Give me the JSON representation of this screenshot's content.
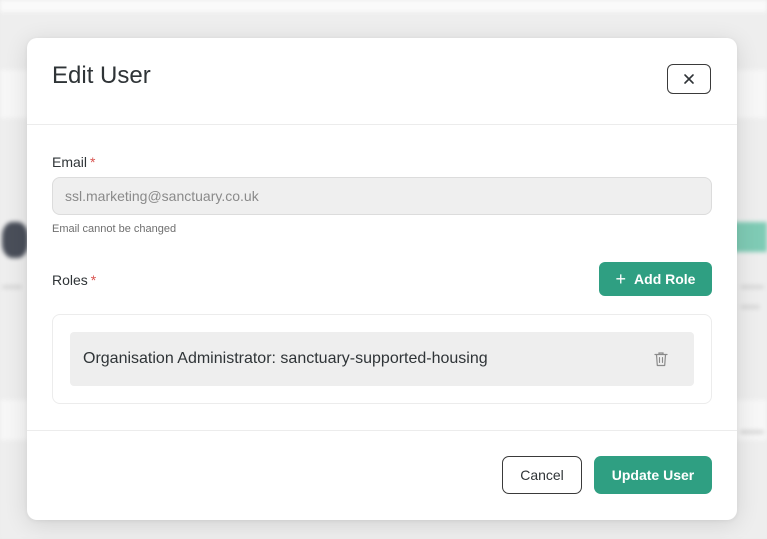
{
  "modal": {
    "title": "Edit User",
    "close_icon": "close-icon"
  },
  "email": {
    "label": "Email",
    "required_marker": "*",
    "value": "ssl.marketing@sanctuary.co.uk",
    "hint": "Email cannot be changed"
  },
  "roles": {
    "label": "Roles",
    "required_marker": "*",
    "add_label": "Add Role",
    "add_icon": "plus-icon",
    "items": [
      {
        "label": "Organisation Administrator: sanctuary-supported-housing",
        "delete_icon": "trash-icon"
      }
    ]
  },
  "footer": {
    "cancel_label": "Cancel",
    "submit_label": "Update User"
  },
  "colors": {
    "accent": "#2f9f82",
    "required": "#d9534f"
  }
}
